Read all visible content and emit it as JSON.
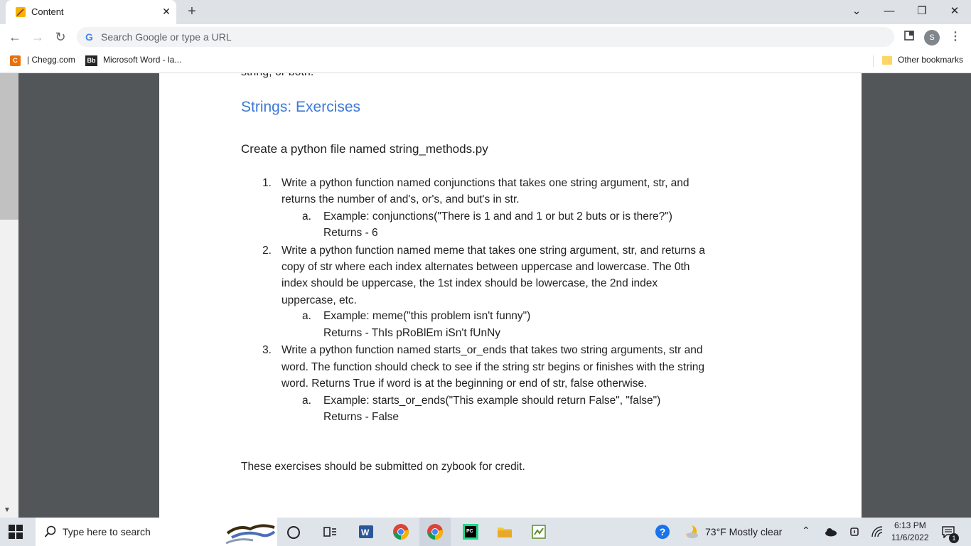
{
  "browser": {
    "tab_title": "Content",
    "omnibox_placeholder": "Search Google or type a URL",
    "profile_initial": "S",
    "bookmarks": [
      {
        "icon": "C",
        "label": "| Chegg.com"
      },
      {
        "icon": "Bb",
        "label": "Microsoft Word - la..."
      }
    ],
    "other_bookmarks": "Other bookmarks"
  },
  "document": {
    "cut_text": "string, or both.",
    "heading": "Strings: Exercises",
    "intro": "Create a python file named string_methods.py",
    "items": [
      {
        "number": "1.",
        "lines": [
          "Write a python function named conjunctions that takes one string argument, str, and",
          "returns the number of and's, or's, and but's in str."
        ],
        "sub_letter": "a.",
        "example": "Example: conjunctions(\"There is 1 and and 1 or but 2 buts or is there?\")",
        "returns": "Returns  - 6"
      },
      {
        "number": "2.",
        "lines": [
          "Write a python function named meme that takes one string argument, str, and returns a",
          "copy of str where each index alternates between uppercase and lowercase. The 0th",
          "index should be uppercase, the 1st index should be lowercase, the 2nd index",
          "uppercase, etc."
        ],
        "sub_letter": "a.",
        "example": "Example: meme(\"this problem isn't funny\")",
        "returns": "Returns - ThIs pRoBlEm iSn't fUnNy"
      },
      {
        "number": "3.",
        "lines": [
          "Write a python function named starts_or_ends that takes two string arguments, str and",
          "word. The function should check to see if the string str begins or finishes with the string",
          "word. Returns True if word is at the beginning or end of str, false otherwise."
        ],
        "sub_letter": "a.",
        "example": "Example: starts_or_ends(\"This example should return False\", \"false\")",
        "returns": "Returns - False"
      }
    ],
    "footer": "These exercises should be submitted on zybook for credit."
  },
  "taskbar": {
    "search_placeholder": "Type here to search",
    "weather": "73°F  Mostly clear",
    "time": "6:13 PM",
    "date": "11/6/2022",
    "notification_count": "1"
  }
}
